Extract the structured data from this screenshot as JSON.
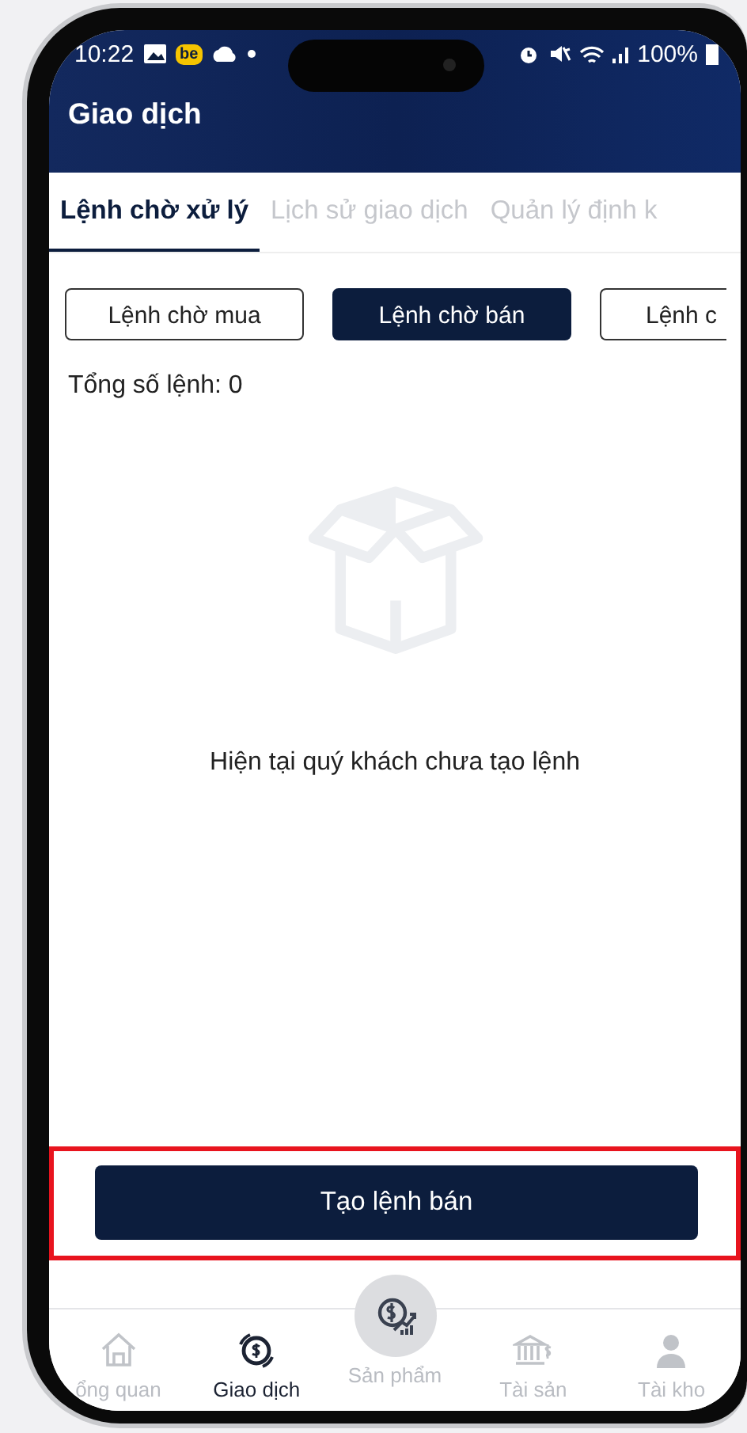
{
  "status_bar": {
    "time": "10:22",
    "app_badge": "be",
    "battery": "100%"
  },
  "header": {
    "title": "Giao dịch"
  },
  "tabs": [
    {
      "label": "Lệnh chờ xử lý",
      "selected": true
    },
    {
      "label": "Lịch sử giao dịch",
      "selected": false
    },
    {
      "label": "Quản lý định k",
      "selected": false
    }
  ],
  "filters": [
    {
      "label": "Lệnh chờ mua",
      "selected": false
    },
    {
      "label": "Lệnh chờ bán",
      "selected": true
    },
    {
      "label": "Lệnh c",
      "selected": false
    }
  ],
  "order_count": "Tổng số lệnh: 0",
  "empty_state": {
    "message": "Hiện tại quý khách chưa tạo lệnh"
  },
  "create_button": {
    "label": "Tạo lệnh bán",
    "highlighted": true
  },
  "bottom_nav": [
    {
      "kind": "home",
      "label": "ổng quan",
      "selected": false
    },
    {
      "kind": "exchange",
      "label": "Giao dịch",
      "selected": true
    },
    {
      "kind": "product",
      "label": "Sản phẩm",
      "selected": false
    },
    {
      "kind": "bank",
      "label": "Tài sản",
      "selected": false
    },
    {
      "kind": "user",
      "label": "Tài kho",
      "selected": false
    }
  ]
}
